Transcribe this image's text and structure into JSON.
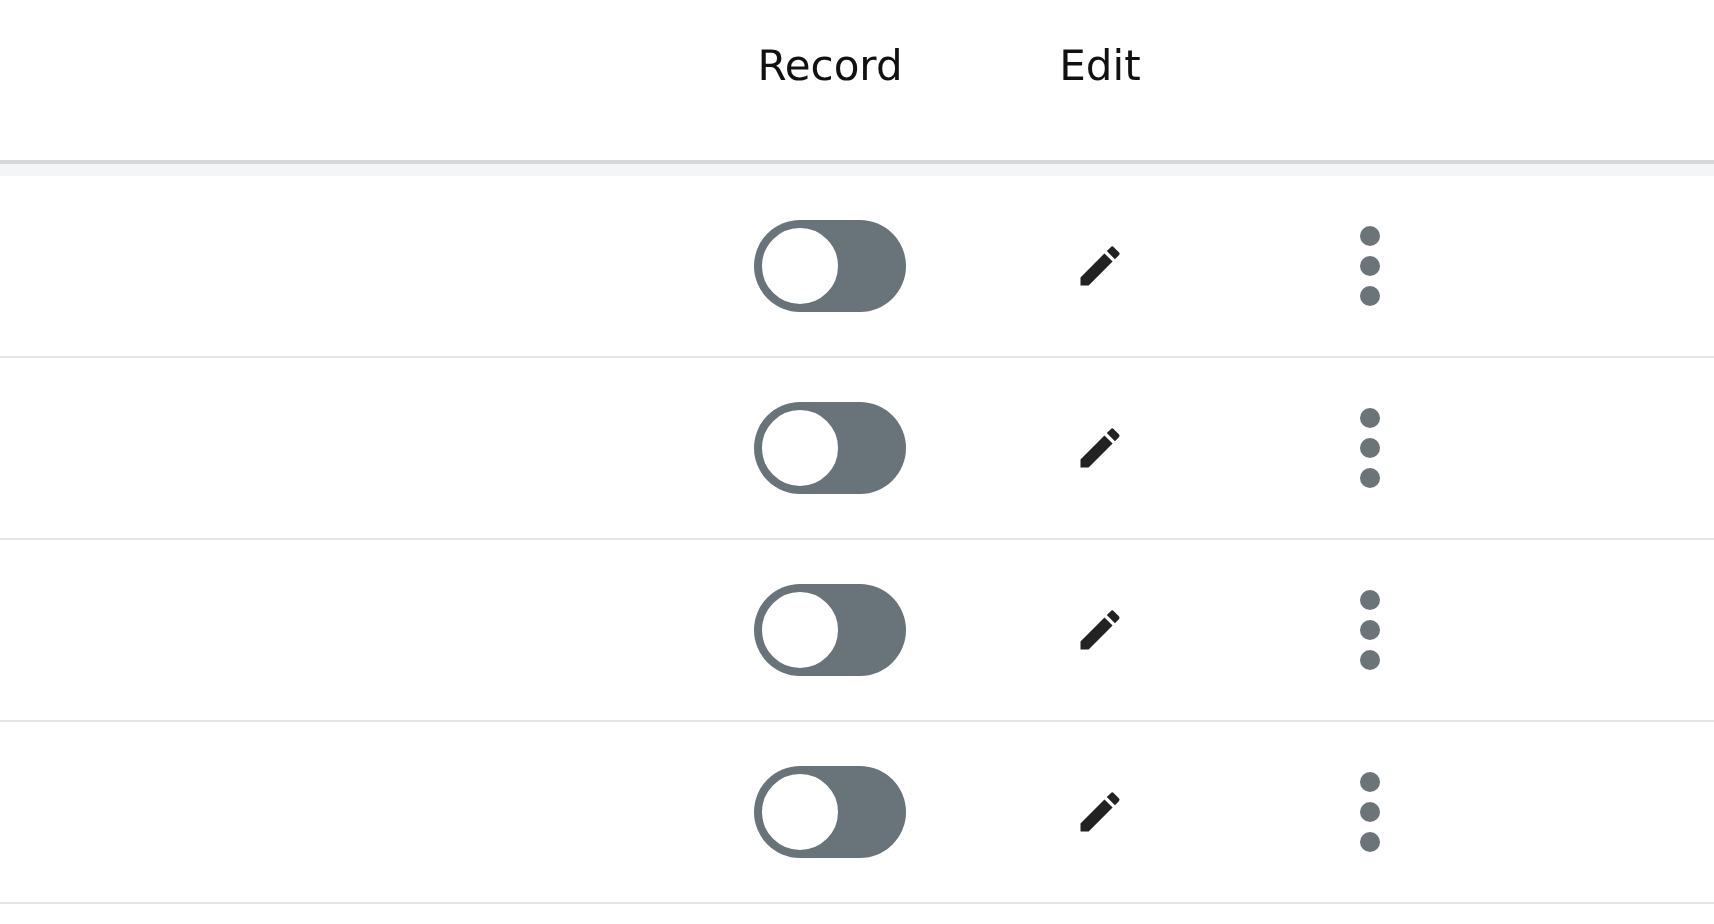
{
  "table": {
    "columns": [
      "Record",
      "Edit"
    ],
    "rows": [
      {
        "record": false
      },
      {
        "record": false
      },
      {
        "record": false
      },
      {
        "record": false
      }
    ]
  }
}
